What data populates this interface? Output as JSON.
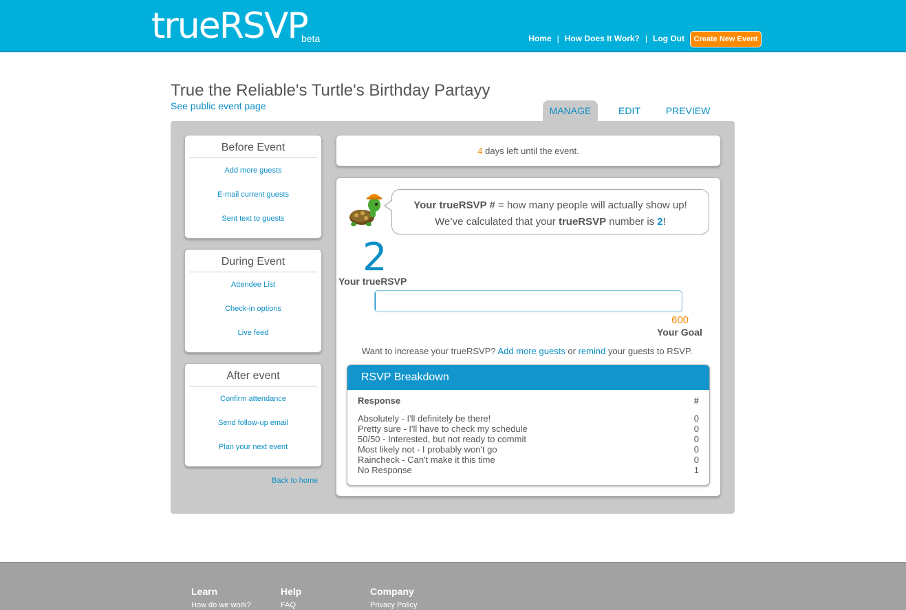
{
  "header": {
    "logo": "trueRSVP",
    "logo_beta": "beta",
    "nav": [
      "Home",
      "How Does It Work?",
      "Log Out"
    ],
    "nav_sep": "|",
    "create_button": "Create New Event"
  },
  "event": {
    "title": "True the Reliable's Turtle's Birthday Partayy",
    "public_link": "See public event page"
  },
  "tabs": [
    "MANAGE",
    "EDIT",
    "PREVIEW"
  ],
  "sidebar": {
    "before": {
      "title": "Before Event",
      "links": [
        "Add more guests",
        "E-mail current guests",
        "Sent text to guests"
      ]
    },
    "during": {
      "title": "During Event",
      "links": [
        "Attendee List",
        "Check-in options",
        "Live feed"
      ]
    },
    "after": {
      "title": "After event",
      "links": [
        "Confirm attendance",
        "Send follow-up email",
        "Plan your next event"
      ]
    },
    "back_home": "Back to home"
  },
  "countdown": {
    "days": "4",
    "text": " days left until the event."
  },
  "bubble": {
    "line1_bold": "Your trueRSVP #",
    "line1_rest": " = how many people will actually show up!",
    "line2_start": "We’ve calculated that your ",
    "line2_bold": "trueRSVP",
    "line2_mid": " number is ",
    "line2_num": "2",
    "line2_end": "!"
  },
  "truersvp": {
    "value": "2",
    "label": "Your trueRSVP"
  },
  "goal": {
    "value": "600",
    "label": "Your Goal",
    "progress_fraction": 0.0033
  },
  "increase": {
    "prefix": "Want to increase your trueRSVP? ",
    "link1": "Add more guests",
    "mid": " or ",
    "link2": "remind",
    "suffix": " your guests to RSVP."
  },
  "breakdown": {
    "title": "RSVP Breakdown",
    "col_response": "Response",
    "col_count": "#",
    "rows": [
      {
        "response": "Absolutely - I'll definitely be there!",
        "count": "0"
      },
      {
        "response": "Pretty sure - I'll have to check my schedule",
        "count": "0"
      },
      {
        "response": "50/50 - Interested, but not ready to commit",
        "count": "0"
      },
      {
        "response": "Most likely not - I probably won't go",
        "count": "0"
      },
      {
        "response": "Raincheck - Can't make it this time",
        "count": "0"
      },
      {
        "response": "No Response",
        "count": "1"
      }
    ]
  },
  "footer": {
    "learn": {
      "title": "Learn",
      "link": "How do we work?"
    },
    "help": {
      "title": "Help",
      "link": "FAQ"
    },
    "company": {
      "title": "Company",
      "link": "Privacy Policy"
    }
  },
  "colors": {
    "brand": "#00b0db",
    "accent": "#ff8a00",
    "link": "#0a8ec5"
  }
}
